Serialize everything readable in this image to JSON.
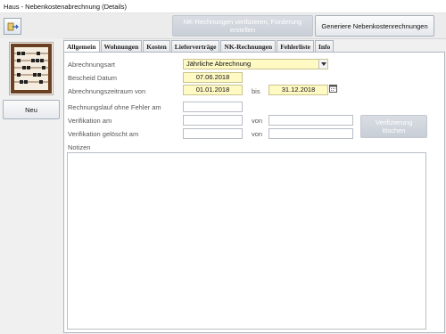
{
  "window": {
    "title": "Haus - Nebenkostenabrechnung (Details)"
  },
  "toolbar": {
    "icon": "form-exit-icon",
    "verify_button": "NK-Rechnungen verifizieren, Forderung erstellen",
    "generate_button": "Generiere Nebenkostenrechnungen"
  },
  "sidebar": {
    "image": "abacus-icon",
    "new_button": "Neu"
  },
  "tabs": [
    "Allgemein",
    "Wohnungen",
    "Kosten",
    "Lieferverträge",
    "NK-Rechnungen",
    "Fehlerliste",
    "Info"
  ],
  "form": {
    "billing_type_label": "Abrechnungsart",
    "billing_type_value": "Jährliche Abrechnung",
    "notice_date_label": "Bescheid Datum",
    "notice_date_value": "07.06.2018",
    "period_label": "Abrechnungszeitraum von",
    "period_from": "01.01.2018",
    "period_to_label": "bis",
    "period_to": "31.12.2018",
    "run_no_errors_label": "Rechnungslauf ohne Fehler am",
    "run_no_errors_value": "",
    "verification_label": "Verifikation am",
    "verification_value": "",
    "verification_by_label": "von",
    "verification_by_value": "",
    "verification_deleted_label": "Verifikation gelöscht am",
    "verification_deleted_value": "",
    "verification_deleted_by_label": "von",
    "verification_deleted_by_value": "",
    "delete_verification_button": "Verifizierung löschen",
    "notes_label": "Notizen",
    "notes_value": ""
  }
}
